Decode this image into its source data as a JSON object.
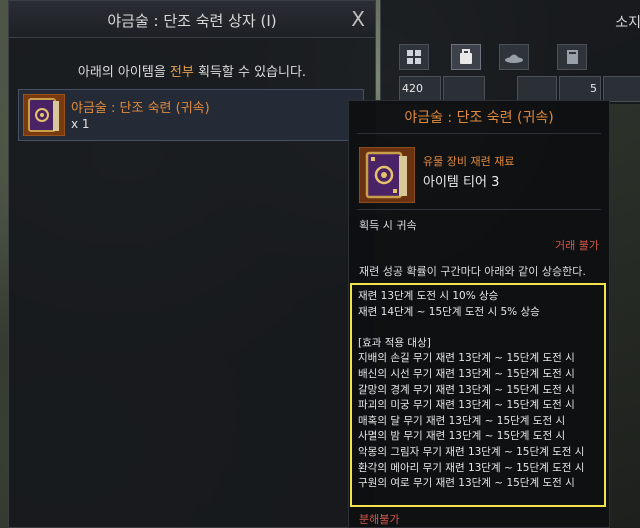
{
  "box": {
    "title": "야금술 : 단조 숙련 상자 (I)",
    "close": "X",
    "desc_prefix": "아래의 아이템을 ",
    "desc_highlight": "전부",
    "desc_suffix": " 획득할 수 있습니다.",
    "item_name": "야금술 : 단조 숙련 (귀속)",
    "item_qty": "x 1"
  },
  "inventory": {
    "title": "소지",
    "slot_count_1": "420",
    "slot_count_2": "5",
    "tabs": [
      "grid-icon",
      "bag-icon",
      "hat-icon",
      "book-icon"
    ]
  },
  "tooltip": {
    "title": "야금술 : 단조 숙련 (귀속)",
    "grade": "유물 장비 재련 재료",
    "tier": "아이템 티어 3",
    "bind": "획득 시 귀속",
    "trade": "거래 불가",
    "desc": "재련 성공 확률이 구간마다 아래와 같이 상승한다.",
    "effects": [
      "재련 13단계 도전 시 10% 상승",
      "재련 14단계 ~ 15단계 도전 시 5% 상승",
      "",
      "[효과 적용 대상]",
      "지배의 손길 무기 재련 13단계 ~ 15단계 도전 시",
      "배신의 시선 무기 재련 13단계 ~ 15단계 도전 시",
      "갈망의 경계 무기 재련 13단계 ~ 15단계 도전 시",
      "파괴의 미궁 무기 재련 13단계 ~ 15단계 도전 시",
      "매혹의 달 무기 재련 13단계 ~ 15단계 도전 시",
      "사멸의 밤 무기 재련 13단계 ~ 15단계 도전 시",
      "악몽의 그림자 무기 재련 13단계 ~ 15단계 도전 시",
      "환각의 메아리 무기 재련 13단계 ~ 15단계 도전 시",
      "구원의 여로 무기 재련 13단계 ~ 15단계 도전 시"
    ],
    "dismantle": "분해불가"
  },
  "colors": {
    "accent_orange": "#e08a3c",
    "highlight_box": "#f2e34a",
    "warning_red": "#d2574a"
  }
}
